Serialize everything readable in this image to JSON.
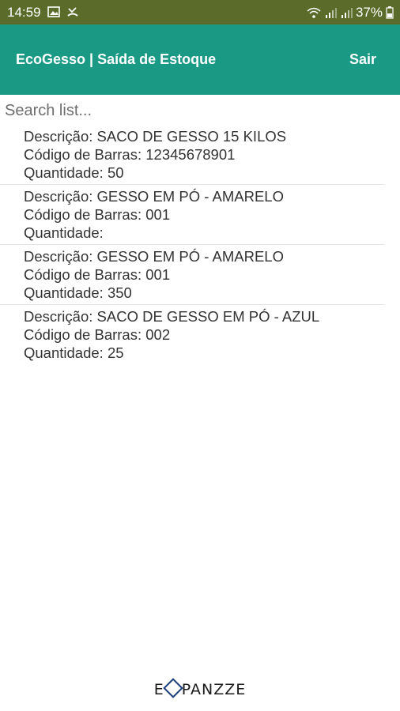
{
  "status_bar": {
    "time": "14:59",
    "battery": "37%",
    "icons": [
      "image-icon",
      "missed-call-icon",
      "wifi-icon",
      "signal-icon",
      "signal-icon",
      "battery-icon"
    ]
  },
  "app_bar": {
    "title": "EcoGesso | Saída de Estoque",
    "action_label": "Sair",
    "color": "#1a9984"
  },
  "search": {
    "placeholder": "Search list...",
    "value": ""
  },
  "items": [
    {
      "descricao": "Descrição: SACO DE GESSO 15 KILOS",
      "codigo": "Código de Barras: 12345678901",
      "quantidade": "Quantidade: 50"
    },
    {
      "descricao": "Descrição: GESSO EM PÓ - AMARELO",
      "codigo": "Código de Barras: 001",
      "quantidade": "Quantidade:"
    },
    {
      "descricao": "Descrição: GESSO EM PÓ - AMARELO",
      "codigo": "Código de Barras: 001",
      "quantidade": "Quantidade: 350"
    },
    {
      "descricao": "Descrição: SACO DE GESSO EM PÓ - AZUL",
      "codigo": "Código de Barras: 002",
      "quantidade": "Quantidade: 25"
    }
  ],
  "footer": {
    "logo_left": "E",
    "logo_right": "PANZZE"
  }
}
